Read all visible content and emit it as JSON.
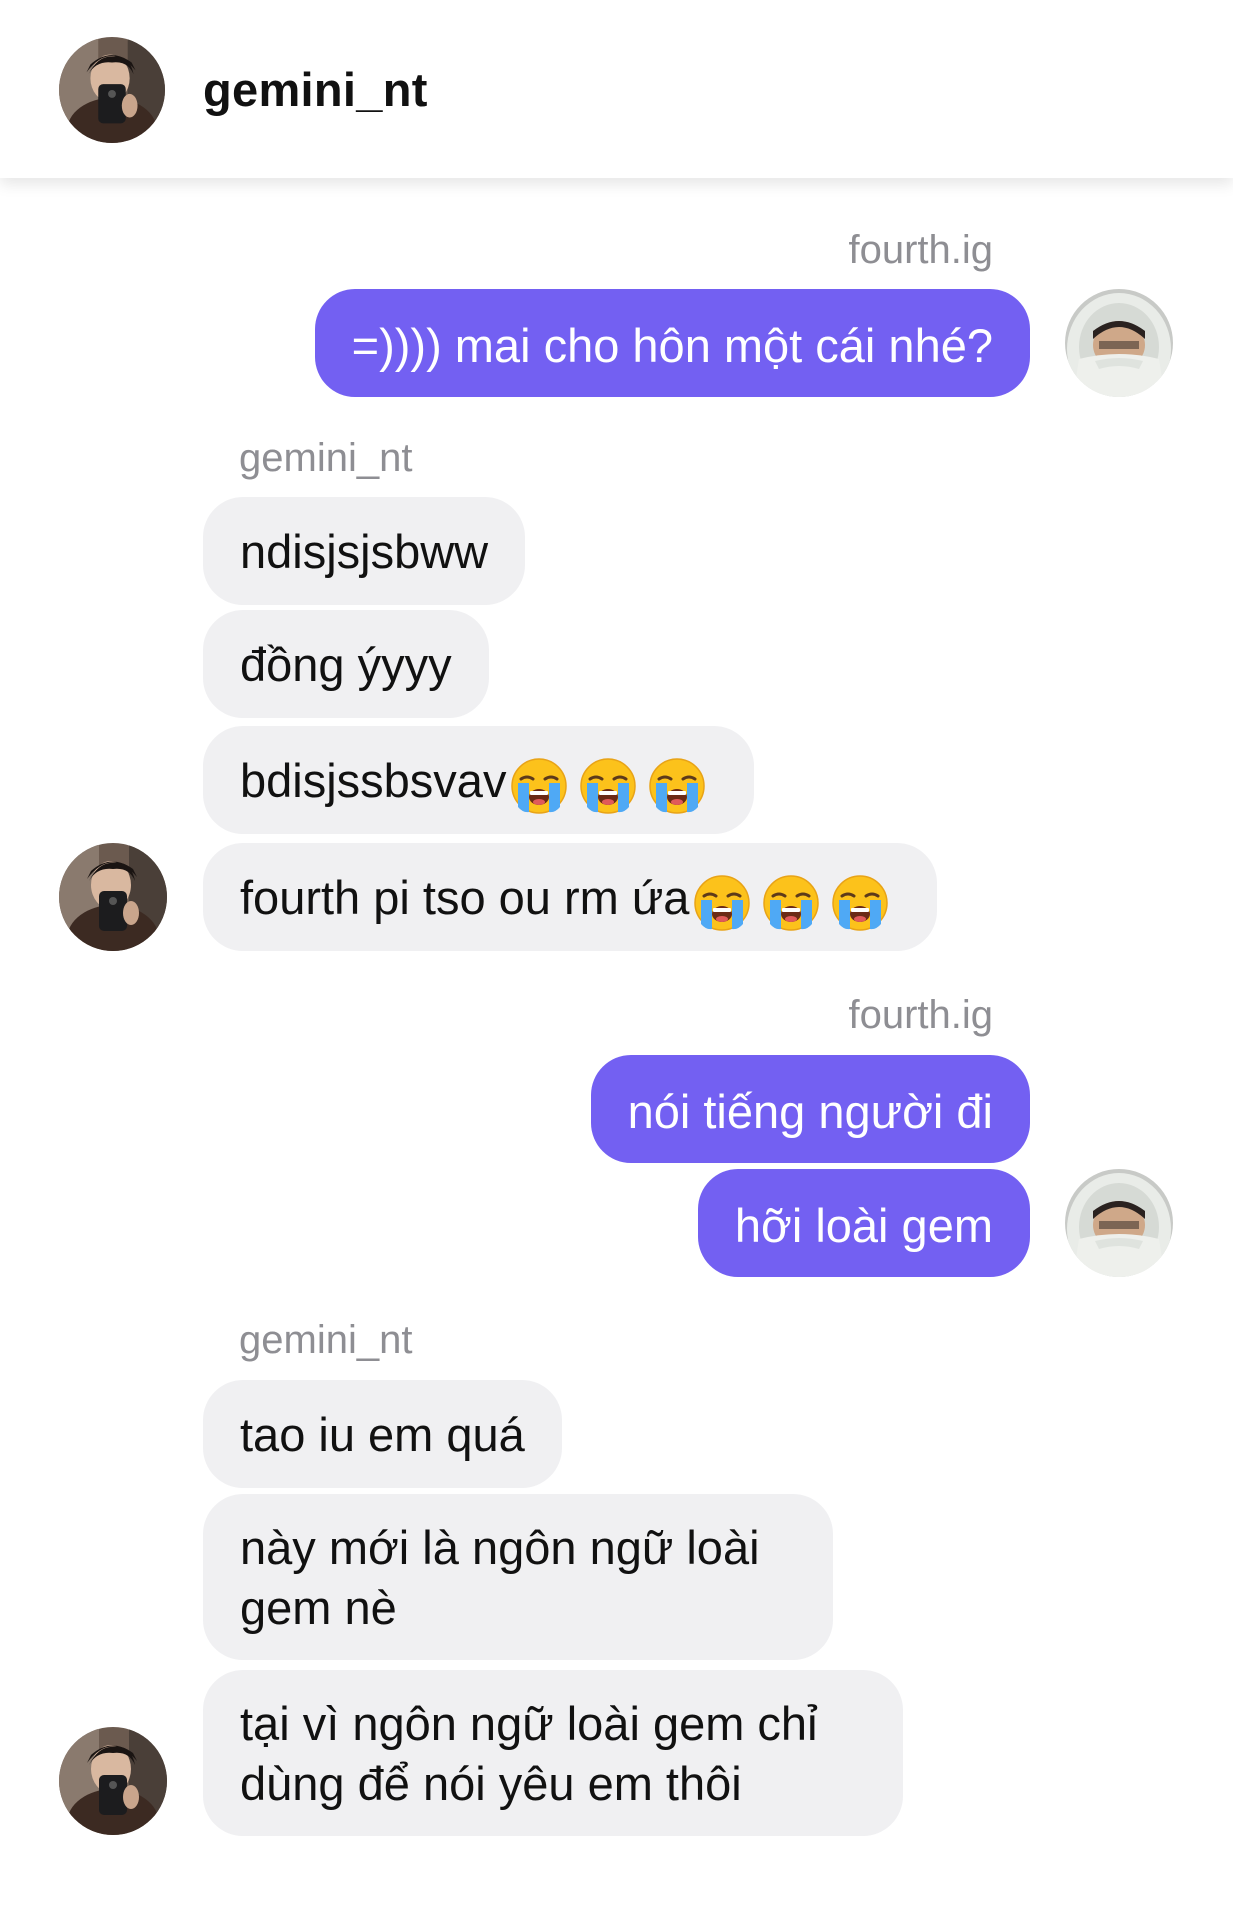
{
  "header": {
    "title": "gemini_nt",
    "avatar_icon": "profile-photo-gemini"
  },
  "colors": {
    "outgoing_bubble": "#7360f2",
    "incoming_bubble": "#f0f0f2",
    "sender_label": "#8e8e93"
  },
  "groups": [
    {
      "sender": "fourth.ig",
      "direction": "outgoing",
      "messages": [
        "=)))) mai cho hôn một cái nhé?"
      ]
    },
    {
      "sender": "gemini_nt",
      "direction": "incoming",
      "messages": [
        "ndisjsjsbww",
        "đồng ýyyy",
        "bdisjssbsvav",
        "fourth pi tso ou rm ứa"
      ],
      "emoji": "loudly-crying-face-emoji"
    },
    {
      "sender": "fourth.ig",
      "direction": "outgoing",
      "messages": [
        "nói tiếng người đi",
        "hỡi loài gem"
      ]
    },
    {
      "sender": "gemini_nt",
      "direction": "incoming",
      "messages": [
        "tao iu em quá",
        "này mới là ngôn ngữ loài gem nè",
        "tại vì ngôn ngữ loài gem chỉ dùng để nói yêu em thôi"
      ]
    }
  ]
}
